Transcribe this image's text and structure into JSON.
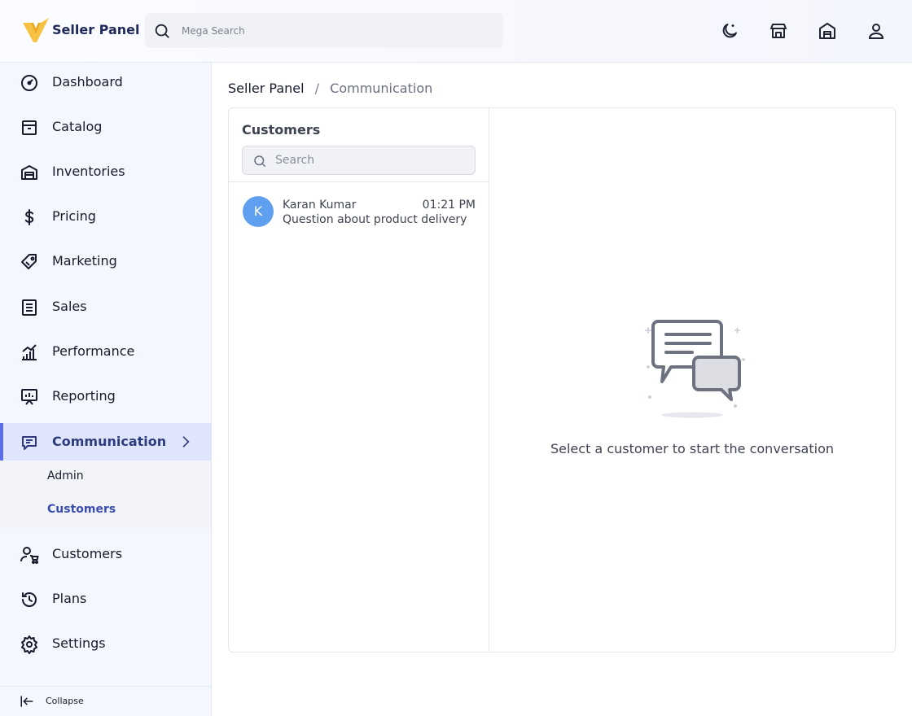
{
  "header": {
    "brand": "Seller Panel",
    "search_placeholder": "Mega Search",
    "icons": [
      "moon-icon",
      "storefront-icon",
      "warehouse-icon",
      "user-icon"
    ]
  },
  "sidebar": {
    "items": [
      {
        "label": "Dashboard",
        "icon": "gauge-icon"
      },
      {
        "label": "Catalog",
        "icon": "box-icon"
      },
      {
        "label": "Inventories",
        "icon": "warehouse-icon"
      },
      {
        "label": "Pricing",
        "icon": "dollar-icon"
      },
      {
        "label": "Marketing",
        "icon": "ticket-icon"
      },
      {
        "label": "Sales",
        "icon": "receipt-icon"
      },
      {
        "label": "Performance",
        "icon": "bar-chart-icon"
      },
      {
        "label": "Reporting",
        "icon": "presentation-icon"
      },
      {
        "label": "Communication",
        "icon": "chat-icon",
        "active": true
      },
      {
        "label": "Customers",
        "icon": "users-cart-icon"
      },
      {
        "label": "Plans",
        "icon": "history-icon"
      },
      {
        "label": "Settings",
        "icon": "gear-icon"
      }
    ],
    "submenu": [
      {
        "label": "Admin"
      },
      {
        "label": "Customers",
        "active": true
      }
    ],
    "collapse_label": "Collapse",
    "active_color": "#5b6ee8"
  },
  "breadcrumb": {
    "home": "Seller Panel",
    "separator": "/",
    "current": "Communication"
  },
  "customers_panel": {
    "title": "Customers",
    "search_placeholder": "Search",
    "conversations": [
      {
        "initial": "K",
        "name": "Karan Kumar",
        "time": "01:21 PM",
        "preview": "Question about product delivery",
        "avatar_color": "#5f9ff0"
      }
    ]
  },
  "empty_state": {
    "message": "Select a customer to start the conversation"
  }
}
